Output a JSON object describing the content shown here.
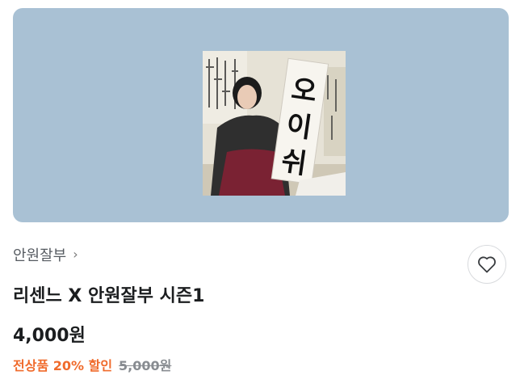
{
  "product": {
    "seller_name": "안원잘부",
    "seller_chevron": "›",
    "title": "리센느 X 안원잘부 시즌1",
    "price": "4,000원",
    "discount_label": "전상품 20% 할인",
    "original_price": "5,000원",
    "image": {
      "banner_text": "오이쉬",
      "description_icon": "photo-thumbnail"
    },
    "wishlist_icon": "heart-outline-icon"
  },
  "colors": {
    "banner_bg": "#a9c1d4",
    "discount": "#f06b2c",
    "text": "#1b1d1f",
    "muted": "#888c91"
  }
}
